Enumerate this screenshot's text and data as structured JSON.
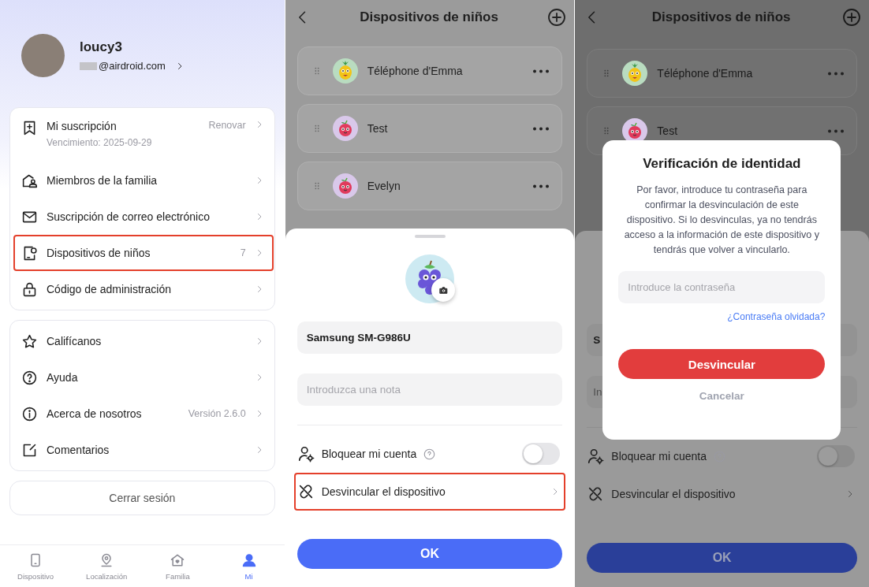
{
  "profile_screen": {
    "user": {
      "name": "loucy3",
      "email": "@airdroid.com"
    },
    "menu_groups": [
      [
        {
          "label": "Mi suscripción",
          "subtitle": "Vencimiento: 2025-09-29",
          "value": "Renovar",
          "highlighted": false
        },
        {
          "label": "Miembros de la familia",
          "highlighted": false
        },
        {
          "label": "Suscripción de correo electrónico",
          "highlighted": false
        },
        {
          "label": "Dispositivos de niños",
          "value": "7",
          "highlighted": true
        },
        {
          "label": "Código de administración",
          "highlighted": false
        }
      ],
      [
        {
          "label": "Califícanos",
          "highlighted": false
        },
        {
          "label": "Ayuda",
          "highlighted": false
        },
        {
          "label": "Acerca de nosotros",
          "value": "Versión 2.6.0",
          "highlighted": false
        },
        {
          "label": "Comentarios",
          "highlighted": false
        }
      ]
    ],
    "logout_button": "Cerrar sesión",
    "nav": [
      {
        "label": "Dispositivo",
        "selected": false
      },
      {
        "label": "Localización",
        "selected": false
      },
      {
        "label": "Familia",
        "selected": false
      },
      {
        "label": "Mi",
        "selected": true
      }
    ]
  },
  "devices_screen": {
    "title": "Dispositivos de niños",
    "devices": [
      {
        "name": "Téléphone d'Emma",
        "kind": "pineapple"
      },
      {
        "name": "Test",
        "kind": "apple"
      },
      {
        "name": "Evelyn",
        "kind": "apple"
      }
    ],
    "sheet": {
      "name_value": "Samsung SM-G986U",
      "note_placeholder": "Introduzca una nota",
      "lock": {
        "label": "Bloquear mi cuenta",
        "on": false
      },
      "unlink": {
        "label": "Desvincular el dispositivo",
        "highlighted": true
      },
      "ok_button": "OK"
    }
  },
  "verify_screen": {
    "title": "Dispositivos de niños",
    "devices": [
      {
        "name": "Téléphone d'Emma",
        "kind": "pineapple"
      },
      {
        "name": "Test",
        "kind": "apple"
      }
    ],
    "sheet": {
      "name_value": "S",
      "note_placeholder": "In",
      "lock": {
        "label": "Bloquear mi cuenta",
        "on": false
      },
      "unlink": {
        "label": "Desvincular el dispositivo",
        "highlighted": false
      },
      "ok_button": "OK"
    },
    "dialog": {
      "title": "Verificación de identidad",
      "message": "Por favor, introduce tu contraseña para confirmar la desvinculación de este dispositivo. Si lo desvinculas, ya no tendrás acceso a la información de este dispositivo y tendrás que volver a vincularlo.",
      "password_placeholder": "Introduce la contraseña",
      "forgot_link": "¿Contraseña olvidada?",
      "confirm_button": "Desvincular",
      "cancel_button": "Cancelar"
    }
  }
}
